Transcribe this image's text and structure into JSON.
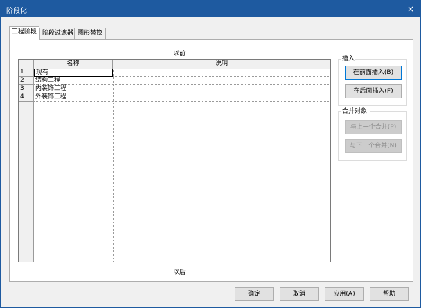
{
  "window": {
    "title": "阶段化",
    "close_glyph": "×"
  },
  "tabs": [
    {
      "label": "工程阶段"
    },
    {
      "label": "阶段过滤器"
    },
    {
      "label": "图形替换"
    }
  ],
  "grid": {
    "label_before": "以前",
    "label_after": "以后",
    "columns": {
      "name": "名称",
      "description": "说明"
    },
    "rows": [
      {
        "num": "1",
        "name": "现有",
        "description": ""
      },
      {
        "num": "2",
        "name": "结构工程",
        "description": ""
      },
      {
        "num": "3",
        "name": "内装饰工程",
        "description": ""
      },
      {
        "num": "4",
        "name": "外装饰工程",
        "description": ""
      }
    ]
  },
  "insert_group": {
    "label": "插入",
    "before_button": "在前面插入(B)",
    "after_button": "在后面插入(F)"
  },
  "merge_group": {
    "label": "合并对象:",
    "prev_button": "与上一个合并(P)",
    "next_button": "与下一个合并(N)"
  },
  "footer": {
    "ok": "确定",
    "cancel": "取消",
    "apply": "应用(A)",
    "help": "帮助"
  }
}
